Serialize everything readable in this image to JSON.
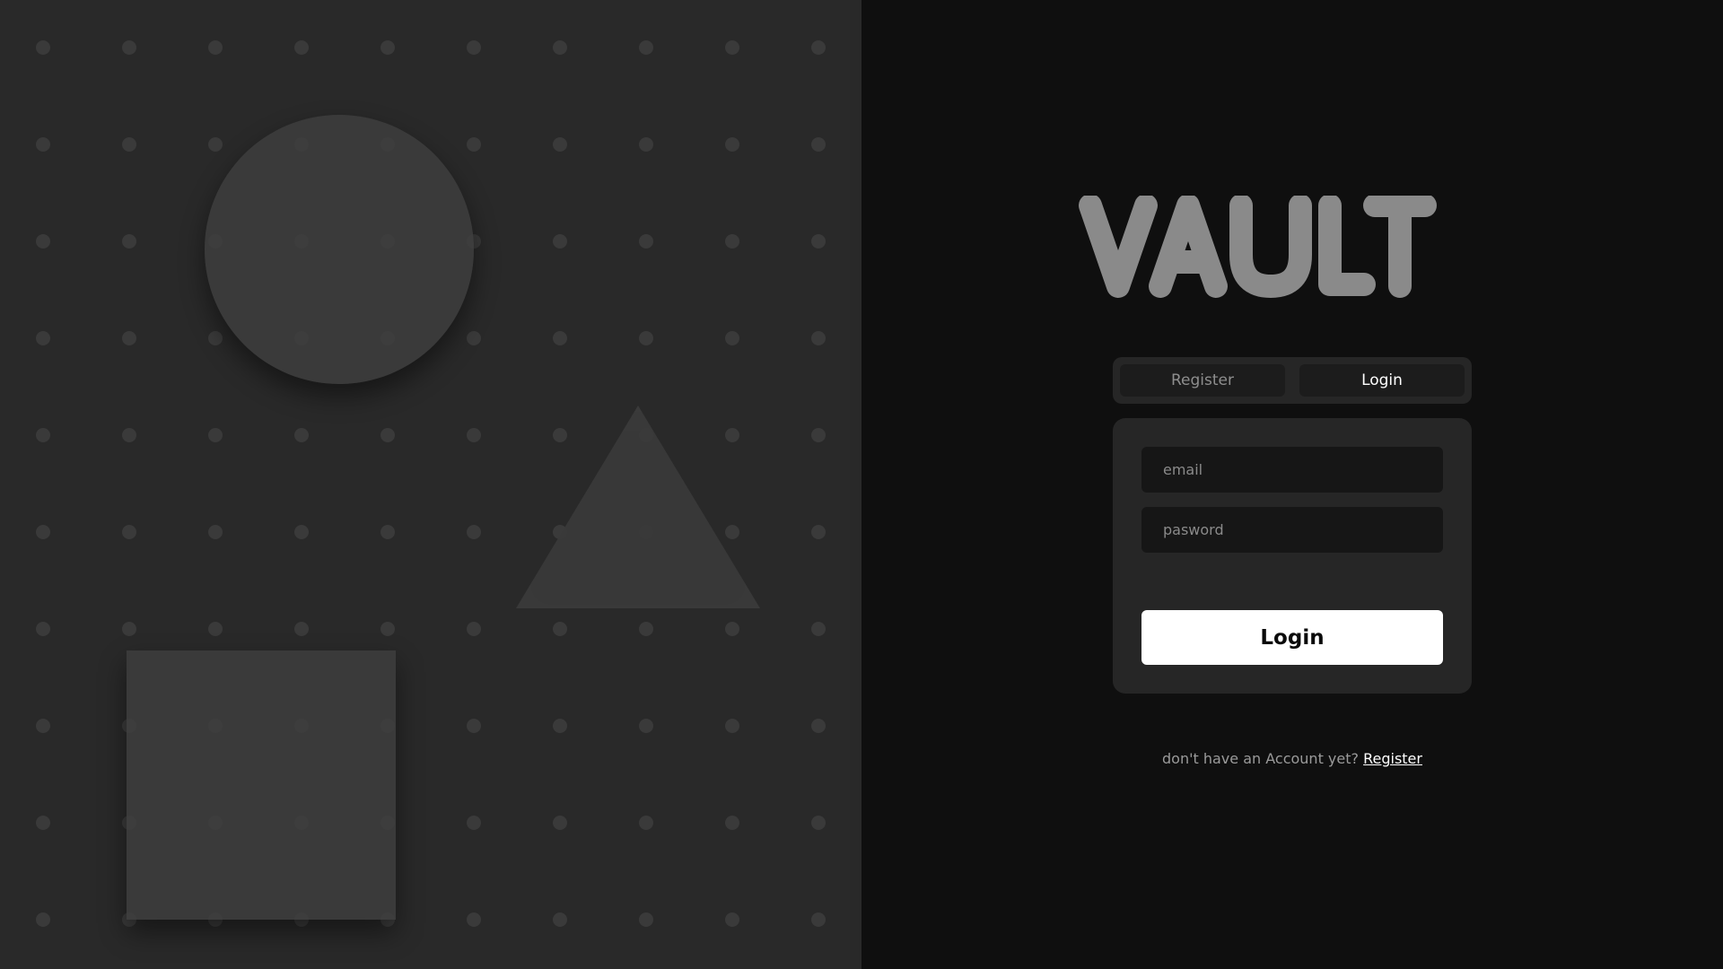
{
  "brand": {
    "logo_text": "VAULT",
    "logo_color": "#8a8a8a"
  },
  "tabs": [
    {
      "label": "Register",
      "active": false
    },
    {
      "label": "Login",
      "active": true
    }
  ],
  "form": {
    "email_placeholder": "email",
    "email_value": "",
    "password_placeholder": "pasword",
    "password_value": "",
    "submit_label": "Login"
  },
  "footer": {
    "prompt_text": "don't have an Account yet?",
    "register_link_label": "Register"
  },
  "colors": {
    "left_panel_bg": "#292929",
    "right_panel_bg": "#0f0f0f",
    "card_bg": "#262626",
    "input_bg": "#161616",
    "primary_button_bg": "#ffffff",
    "shape_fill": "#3e3e3e",
    "dot_fill": "#3a3a3a"
  },
  "decorations": {
    "shapes": [
      "circle",
      "triangle",
      "square"
    ],
    "pattern": "dot-grid"
  }
}
